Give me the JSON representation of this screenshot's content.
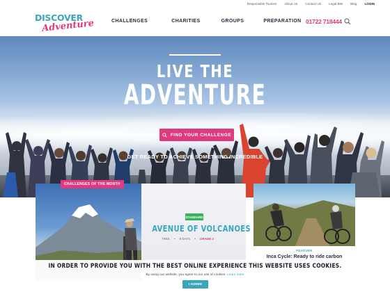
{
  "top_links": [
    "Responsible Tourism",
    "About Us",
    "Contact Us",
    "Legal Bits",
    "Blog",
    "LOGIN"
  ],
  "logo": {
    "line1": "DISCOVER",
    "line2": "Adventure"
  },
  "nav": [
    "CHALLENGES",
    "CHARITIES",
    "GROUPS",
    "PREPARATION"
  ],
  "phone": "01722 718444",
  "search_icon": "search-icon",
  "hero": {
    "title_line1": "LIVE THE",
    "title_line2": "ADVENTURE",
    "cta_label": "FIND YOUR CHALLENGE",
    "cta_icon": "search-icon",
    "tagline": "GET READY TO ACHIEVE SOMETHING INCREDIBLE"
  },
  "featured": {
    "tag": "CHALLENGES OF THE MONTH",
    "badge": "STANDARD",
    "title": "AVENUE OF VOLCANOES TREK",
    "meta_type": "TREK",
    "meta_days": "9 DAYS",
    "meta_grade": "GRADE 3"
  },
  "side_card": {
    "label": "FEATURE",
    "title": "Inca Cycle: Ready to ride carbon"
  },
  "cookie": {
    "title": "IN ORDER TO PROVIDE YOU WITH THE BEST ONLINE EXPERIENCE THIS WEBSITE USES COOKIES.",
    "text": "By using our website, you agree to our use of cookies.",
    "learn_more": "Learn more",
    "button": "I AGREE"
  },
  "colors": {
    "brand_pink": "#e0397e",
    "brand_teal": "#3aa6b9",
    "standard_green": "#35b45a"
  }
}
